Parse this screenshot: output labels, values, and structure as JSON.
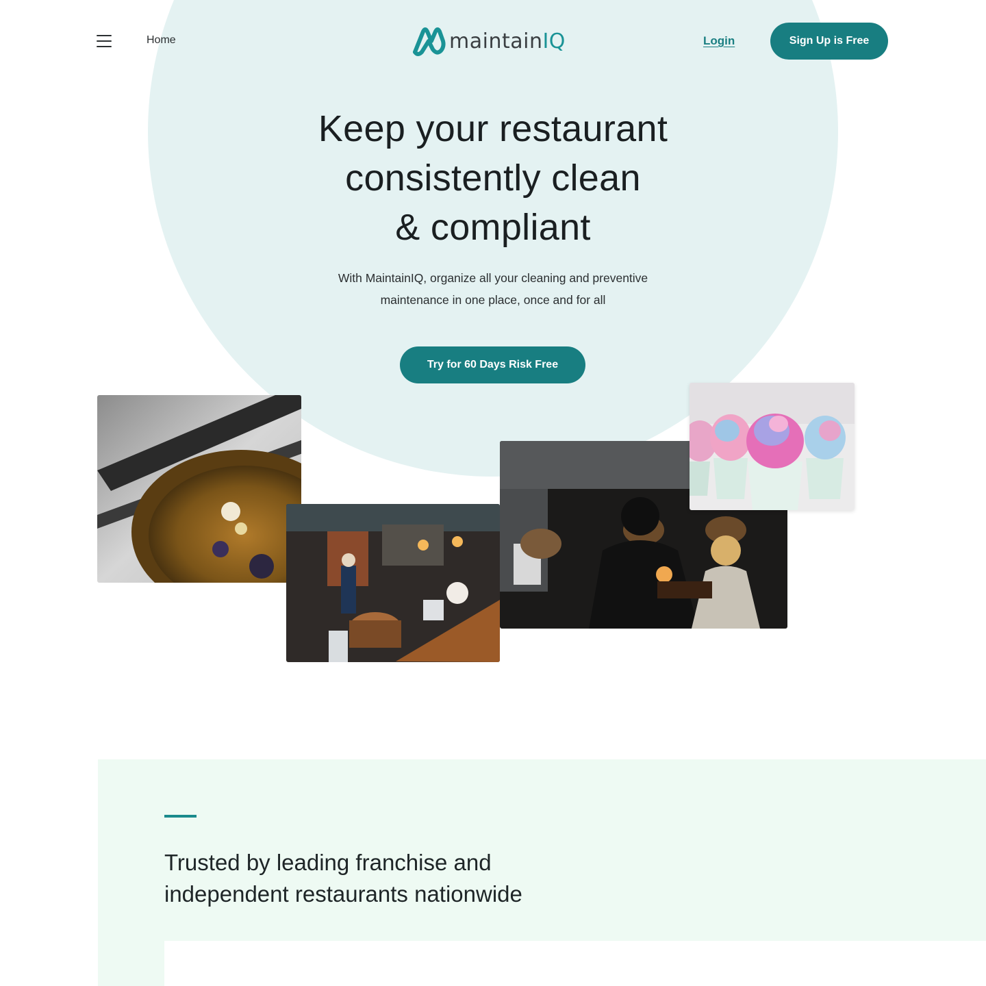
{
  "header": {
    "nav_home": "Home",
    "logo_text_main": "maintain",
    "logo_text_accent": "IQ",
    "login": "Login",
    "signup": "Sign Up is Free",
    "menu_icon": "hamburger-menu-icon"
  },
  "hero": {
    "title_line1": "Keep your restaurant",
    "title_line2": "consistently clean",
    "title_line3": "& compliant",
    "subtitle_line1": "With MaintainIQ, organize all your cleaning and preventive",
    "subtitle_line2": "maintenance in one place, once and for all",
    "cta": "Try for 60 Days Risk Free"
  },
  "trusted": {
    "title_line1": "Trusted by leading franchise and",
    "title_line2": "independent restaurants nationwide"
  },
  "colors": {
    "brand": "#187e81",
    "hero_circle": "#e4f2f2",
    "trusted_bg": "#eefaf3",
    "text": "#1a1f21"
  }
}
